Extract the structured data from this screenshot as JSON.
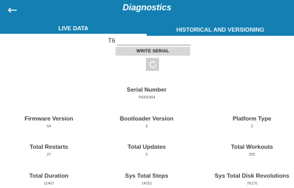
{
  "header": {
    "title": "Diagnostics",
    "back_icon": "arrow-left-icon",
    "background_color": "#137fb2"
  },
  "tabs": [
    {
      "label": "LIVE DATA",
      "active": true
    },
    {
      "label": "HISTORICAL AND VERSIONING",
      "active": false
    }
  ],
  "serial_form": {
    "value": "T6",
    "write_label": "WRITE SERIAL",
    "refresh_icon": "refresh-icon"
  },
  "stats": {
    "serial_number": {
      "label": "Serial Number",
      "value": "T6001004"
    },
    "firmware_version": {
      "label": "Firmware Version",
      "value": "54"
    },
    "bootloader_version": {
      "label": "Bootloader Version",
      "value": "9"
    },
    "platform_type": {
      "label": "Platform Type",
      "value": "2"
    },
    "total_restarts": {
      "label": "Total Restarts",
      "value": "27"
    },
    "total_updates": {
      "label": "Total Updates",
      "value": "0"
    },
    "total_workouts": {
      "label": "Total Workouts",
      "value": "255"
    },
    "total_duration": {
      "label": "Total Duration",
      "value": "11407"
    },
    "sys_total_steps": {
      "label": "Sys Total Steps",
      "value": "14151"
    },
    "sys_total_disk_revolutions": {
      "label": "Sys Total Disk Revolutions",
      "value": "78170"
    }
  }
}
